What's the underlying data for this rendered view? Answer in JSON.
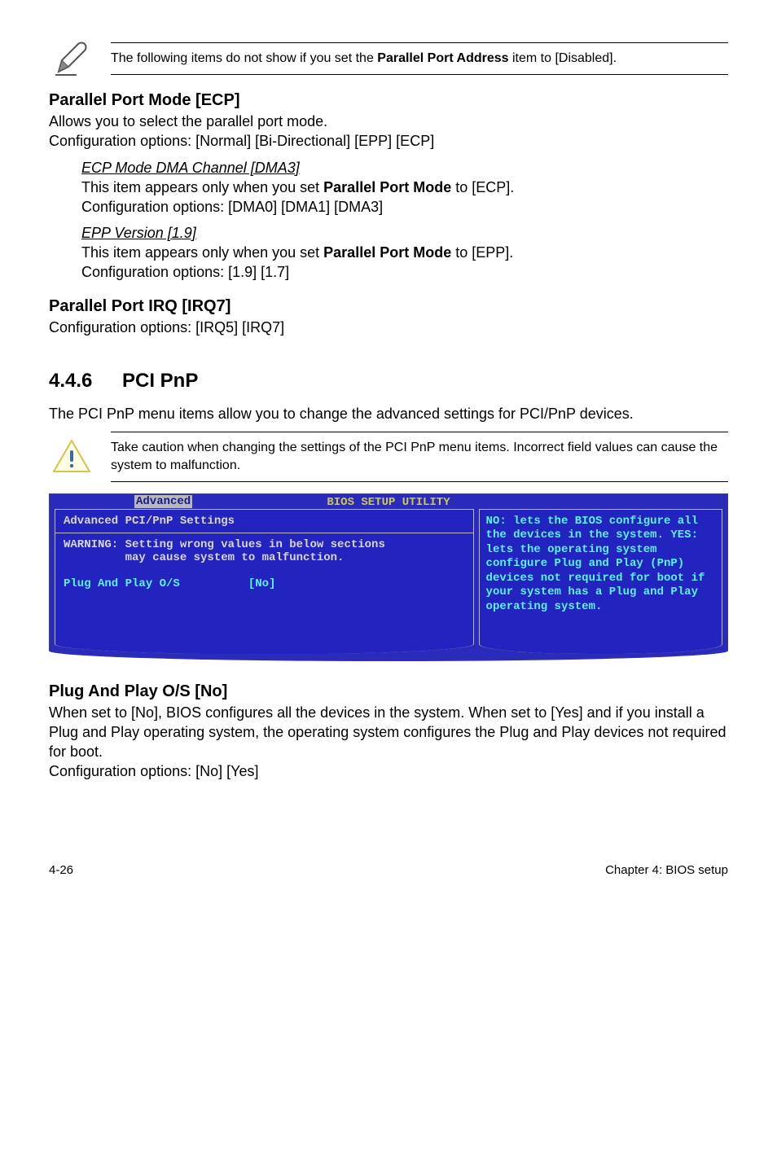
{
  "note1": {
    "text_a": "The following items do not show if you set the ",
    "text_bold": "Parallel Port Address",
    "text_b": " item to [Disabled]."
  },
  "sec1": {
    "heading": "Parallel Port Mode [ECP]",
    "line1": "Allows you to select the parallel port mode.",
    "line2": "Configuration options: [Normal] [Bi-Directional] [EPP] [ECP]",
    "sub1": {
      "heading": "ECP Mode DMA Channel [DMA3]",
      "line_a": "This item appears only when you set ",
      "line_bold": "Parallel Port Mode",
      "line_b": " to [ECP].",
      "line2": "Configuration options: [DMA0] [DMA1] [DMA3]"
    },
    "sub2": {
      "heading": "EPP Version [1.9]",
      "line_a": "This item appears only when you set ",
      "line_bold": "Parallel Port Mode",
      "line_b": " to [EPP].",
      "line2": "Configuration options: [1.9] [1.7]"
    }
  },
  "sec2": {
    "heading": "Parallel Port IRQ [IRQ7]",
    "line1": "Configuration options: [IRQ5] [IRQ7]"
  },
  "sec3": {
    "num": "4.4.6",
    "title": "PCI PnP",
    "intro": "The PCI PnP menu items allow you to change the advanced settings for PCI/PnP devices.",
    "caution": "Take caution when changing the settings of the PCI PnP menu items. Incorrect field values can cause the system to malfunction."
  },
  "bios": {
    "title": "BIOS SETUP UTILITY",
    "tab": "Advanced",
    "left_heading": "Advanced PCI/PnP Settings",
    "warning1": "WARNING: Setting wrong values in below sections",
    "warning2": "         may cause system to malfunction.",
    "row_label": "Plug And Play O/S",
    "row_value": "[No]",
    "right_text": "NO: lets the BIOS configure all the devices in the system. YES: lets the operating system configure Plug and Play (PnP) devices not required for boot if your system has a Plug and Play operating system."
  },
  "sec4": {
    "heading": "Plug And Play O/S [No]",
    "line1": "When set to [No], BIOS configures all the devices in the system. When set to [Yes] and if you install a Plug and Play operating system, the operating system configures the Plug and Play devices not required for boot.",
    "line2": "Configuration options: [No] [Yes]"
  },
  "footer": {
    "left": "4-26",
    "right": "Chapter 4: BIOS setup"
  }
}
